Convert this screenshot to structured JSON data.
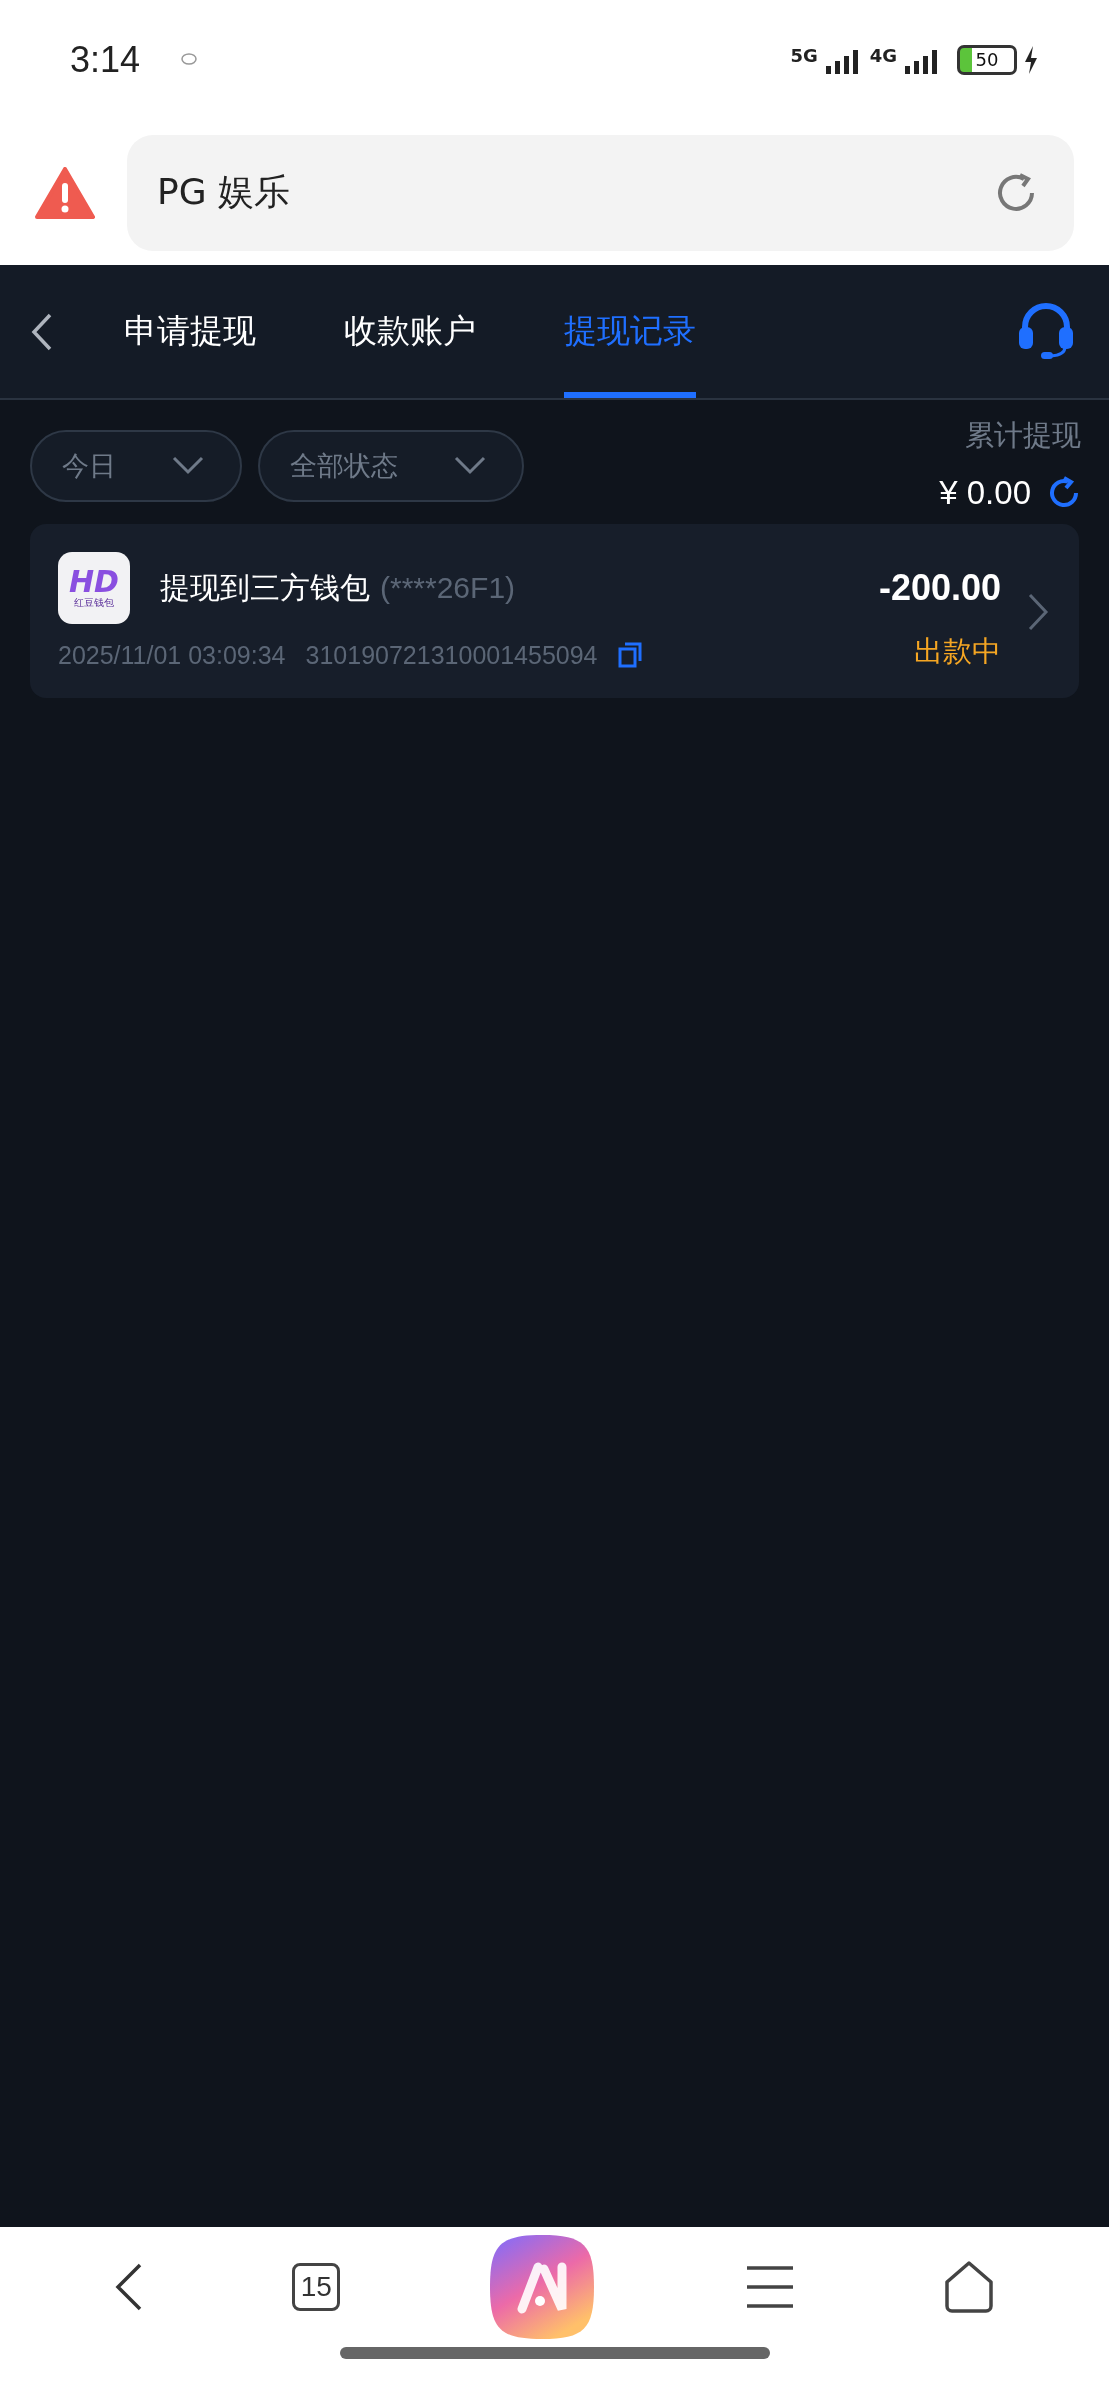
{
  "status_bar": {
    "time": "3:14",
    "network_1": "5G",
    "network_2": "4G",
    "battery": "50"
  },
  "address_bar": {
    "title": "PG 娱乐"
  },
  "header": {
    "tabs": [
      {
        "label": "申请提现",
        "selected": false
      },
      {
        "label": "收款账户",
        "selected": false
      },
      {
        "label": "提现记录",
        "selected": true
      }
    ]
  },
  "filters": [
    {
      "label": "今日"
    },
    {
      "label": "全部状态"
    }
  ],
  "summary": {
    "label": "累计提现",
    "amount": "¥ 0.00"
  },
  "records": [
    {
      "logo_mark": "HD",
      "logo_text": "红豆钱包",
      "title": "提现到三方钱包",
      "account": "(****26F1)",
      "time": "2025/11/01 03:09:34",
      "order_no": "310190721310001455094",
      "amount": "-200.00",
      "status": "出款中",
      "color": "#f5a623"
    }
  ],
  "bottom_nav": {
    "tab_count": "15"
  }
}
